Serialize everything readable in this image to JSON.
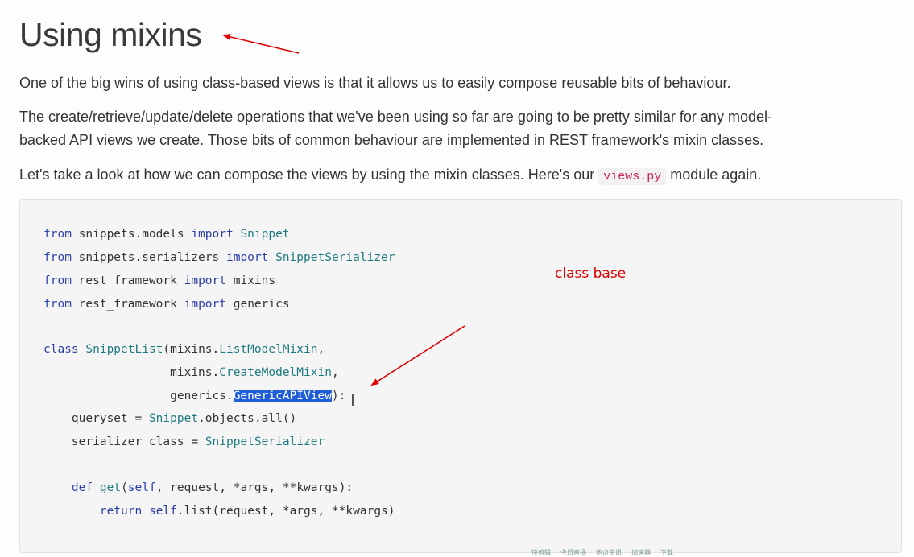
{
  "page": {
    "title": "Using mixins",
    "paragraphs": {
      "p1": "One of the big wins of using class-based views is that it allows us to easily compose reusable bits of behaviour.",
      "p2_line1": "The create/retrieve/update/delete operations that we've been using so far are going to be pretty similar for any model-",
      "p2_line2": "backed API views we create. Those bits of common behaviour are implemented in REST framework's mixin classes.",
      "p3_before": "Let's take a look at how we can compose the views by using the mixin classes. Here's our ",
      "p3_code": "views.py",
      "p3_after": " module again."
    }
  },
  "code": {
    "line1": [
      "from",
      " snippets.models ",
      "import",
      " ",
      "Snippet"
    ],
    "line2": [
      "from",
      " snippets.serializers ",
      "import",
      " ",
      "SnippetSerializer"
    ],
    "line3": [
      "from",
      " rest_framework ",
      "import",
      " mixins"
    ],
    "line4": [
      "from",
      " rest_framework ",
      "import",
      " generics"
    ],
    "line5": [
      "class",
      " ",
      "SnippetList",
      "(mixins.",
      "ListModelMixin",
      ","
    ],
    "line6": [
      "                  mixins.",
      "CreateModelMixin",
      ","
    ],
    "line7": [
      "                  generics.",
      "GenericAPIView",
      "):"
    ],
    "line8": [
      "    queryset = ",
      "Snippet",
      ".objects.all()"
    ],
    "line9": [
      "    serializer_class = ",
      "SnippetSerializer"
    ],
    "line10": [
      "    ",
      "def",
      " ",
      "get",
      "(",
      "self",
      ", request, *args, **kwargs):"
    ],
    "line11": [
      "        ",
      "return",
      " ",
      "self",
      ".list(request, *args, **kwargs)"
    ]
  },
  "annotation": {
    "text": "class base",
    "color": "#e00000"
  },
  "taskbar": [
    "快剪辑",
    "今日直播",
    "热点资讯",
    "加速器",
    "下载"
  ],
  "colors": {
    "keyword": "#2c3fa6",
    "class_name": "#1f7a80",
    "selection": "#1f5ed8",
    "arrow": "#e00000"
  }
}
